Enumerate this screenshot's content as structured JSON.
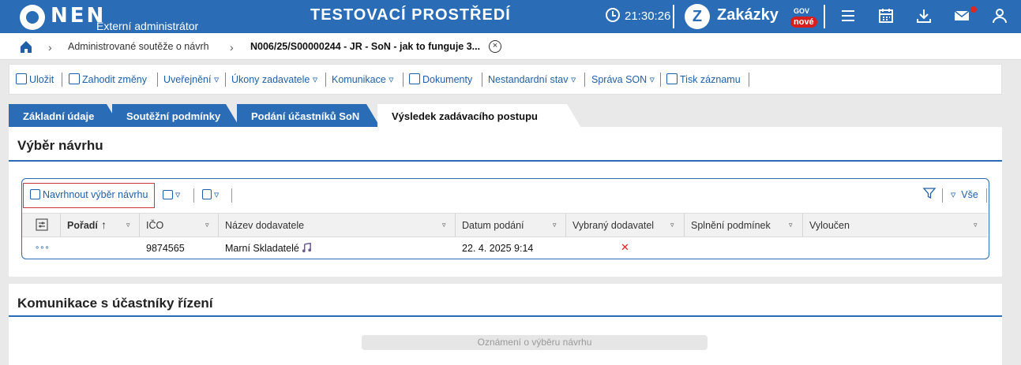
{
  "header": {
    "logo_text": "NEN",
    "role": "Externí administrátor",
    "environment": "TESTOVACÍ PROSTŘEDÍ",
    "time": "21:30:26",
    "zakazky_label": "Zakázky",
    "zakazky_sup": "GOV",
    "zakazky_badge": "nové",
    "zakazky_logo_glyph": "Z",
    "icons": [
      "menu-icon",
      "calendar-icon",
      "download-icon",
      "mail-icon",
      "user-icon"
    ]
  },
  "breadcrumb": {
    "items": [
      "Administrované soutěže o návrh",
      "N006/25/S00000244 - JR - SoN - jak to funguje 3..."
    ],
    "close_glyph": "×"
  },
  "toolbar": {
    "save": "Uložit",
    "discard": "Zahodit změny",
    "publish": "Uveřejnění",
    "actions": "Úkony zadavatele",
    "communication": "Komunikace",
    "documents": "Dokumenty",
    "nonstandard": "Nestandardní stav",
    "son": "Správa SON",
    "print": "Tisk záznamu",
    "dropdown_glyph": "▿"
  },
  "tabs": [
    "Základní údaje",
    "Soutěžní podmínky",
    "Podání účastníků SoN",
    "Výsledek zadávacího postupu"
  ],
  "selection": {
    "title": "Výběr návrhu",
    "propose_button": "Navrhnout výběr návrhu",
    "filter_all": "Vše",
    "columns": [
      "Pořadí",
      "IČO",
      "Název dodavatele",
      "Datum podání",
      "Vybraný dodavatel",
      "Splnění podmínek",
      "Vyloučen"
    ],
    "rows": [
      {
        "menu": "∘∘∘",
        "poradi": "",
        "ico": "9874565",
        "name": "Marní Skladatelé",
        "date": "22. 4. 2025 9:14",
        "selected": "✕",
        "conditions": "",
        "excluded": ""
      }
    ]
  },
  "communication": {
    "title": "Komunikace s účastníky řízení",
    "notice_button": "Oznámení o výběru návrhu"
  }
}
